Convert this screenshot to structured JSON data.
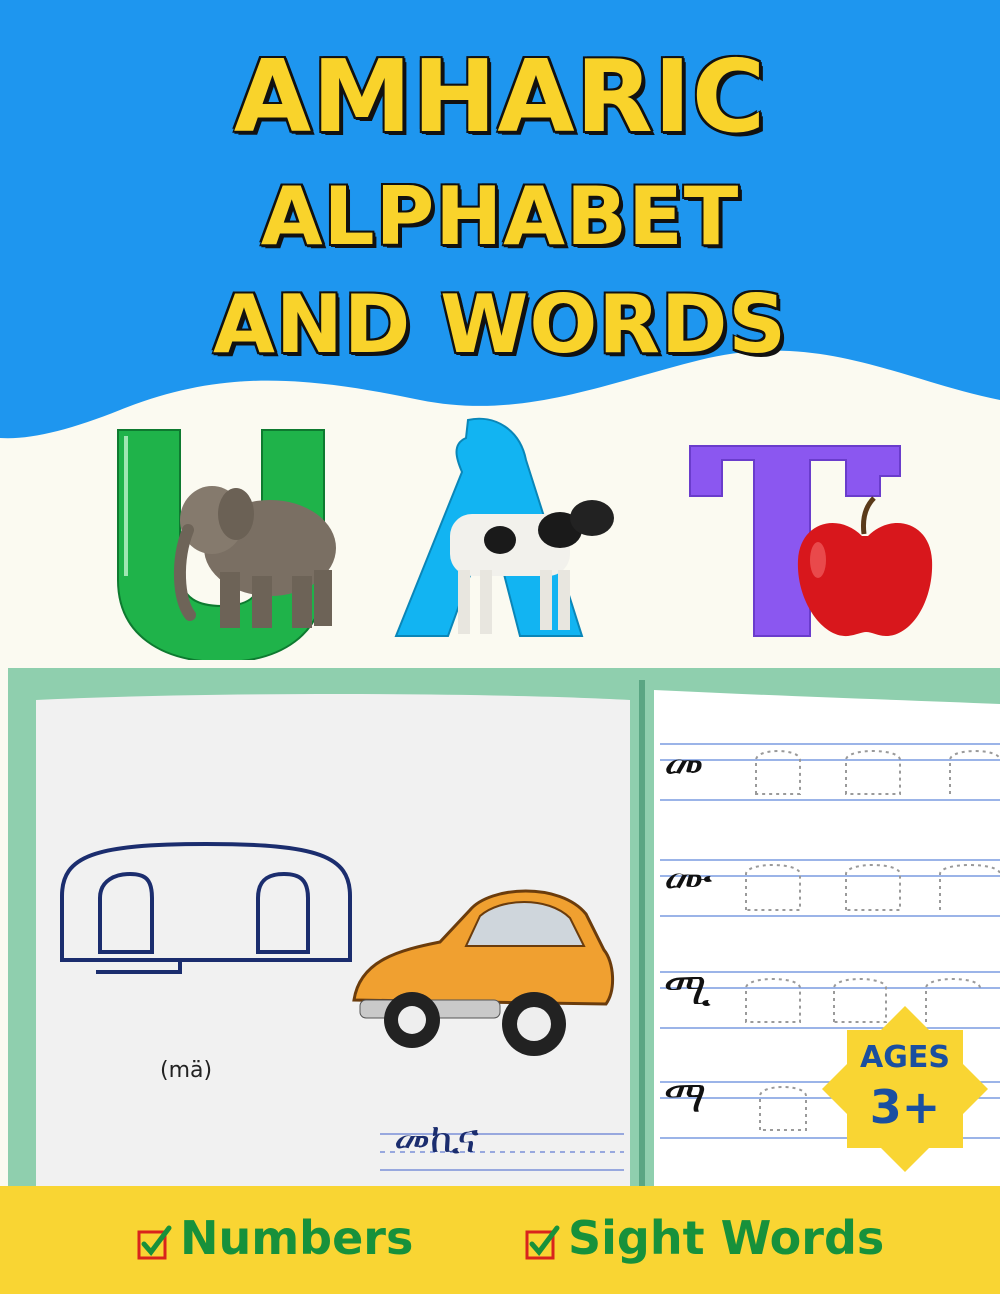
{
  "cover": {
    "title_line1": "AMHARIC",
    "title_line2": "ALPHABET",
    "title_line3": "AND WORDS",
    "letter_1": "ሀ",
    "letter_2": "ለ",
    "letter_3": "ፐ",
    "big_letter": "መ",
    "pronunciation": "(mä)",
    "example_word": "መኪና",
    "practice_letters": [
      "መ",
      "ሙ",
      "ሚ",
      "ማ"
    ],
    "ages_label": "AGES",
    "ages_value": "3+",
    "feature_1": "Numbers",
    "feature_2": "Sight Words"
  },
  "colors": {
    "sky_blue": "#1e96ef",
    "title_yellow": "#f9d32b",
    "letter_green": "#1fb34a",
    "letter_blue": "#12b4f2",
    "letter_purple": "#8b57f0",
    "book_mint": "#8fcfae",
    "bar_yellow": "#f9d533",
    "feature_green": "#17913b"
  },
  "icons": [
    "elephant-icon",
    "cow-icon",
    "apple-icon",
    "car-icon",
    "check-icon"
  ]
}
